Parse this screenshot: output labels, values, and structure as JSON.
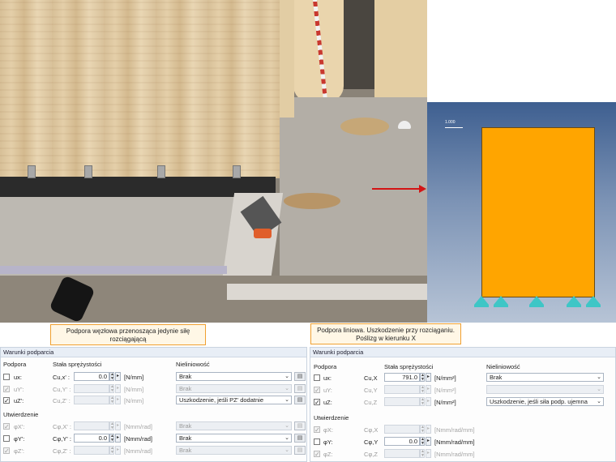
{
  "callouts": {
    "left": "Podpora węzłowa przenosząca jedynie siłę rozciągającą",
    "right": "Podpora liniowa. Uszkodzenie przy rozciąganiu. Poślizg w kierunku X"
  },
  "model_view": {
    "scale_label": "1.000",
    "panel_color": "#ffa500",
    "support_color": "#3ec6c6",
    "background_top": "#3e5f90"
  },
  "left_dialog": {
    "title": "Warunki podparcia",
    "headers": {
      "support": "Podpora",
      "stiffness": "Stała sprężystości",
      "nonlinearity": "Nieliniowość"
    },
    "section_fix": "Utwierdzenie",
    "rows": [
      {
        "label": "ux:",
        "symbol": "Cu,x' :",
        "checked": false,
        "enabled": true,
        "value": "0.0",
        "unit": "[N/mm]",
        "nonlinearity": "Brak",
        "nl_enabled": true
      },
      {
        "label": "uY':",
        "symbol": "Cu,Y' :",
        "checked": true,
        "enabled": false,
        "value": "",
        "unit": "[N/mm]",
        "nonlinearity": "Brak",
        "nl_enabled": false
      },
      {
        "label": "uZ':",
        "symbol": "Cu,Z' :",
        "checked": true,
        "enabled": false,
        "value": "",
        "unit": "[N/mm]",
        "nonlinearity": "Uszkodzenie, jeśli PZ' dodatnie",
        "nl_enabled": true
      }
    ],
    "rot_rows": [
      {
        "label": "φX':",
        "symbol": "Cφ,X' :",
        "checked": true,
        "enabled": false,
        "value": "",
        "unit": "[Nmm/rad]",
        "nonlinearity": "Brak",
        "nl_enabled": false
      },
      {
        "label": "φY':",
        "symbol": "Cφ,Y' :",
        "checked": false,
        "enabled": true,
        "value": "0.0",
        "unit": "[Nmm/rad]",
        "nonlinearity": "Brak",
        "nl_enabled": true
      },
      {
        "label": "φZ':",
        "symbol": "Cφ,Z' :",
        "checked": true,
        "enabled": false,
        "value": "",
        "unit": "[Nmm/rad]",
        "nonlinearity": "Brak",
        "nl_enabled": false
      }
    ]
  },
  "right_dialog": {
    "title": "Warunki podparcia",
    "headers": {
      "support": "Podpora",
      "stiffness": "Stała sprężystości",
      "nonlinearity": "Nieliniowość"
    },
    "section_fix": "Utwierdzenie",
    "rows": [
      {
        "label": "ux:",
        "symbol": "Cu,X",
        "checked": false,
        "enabled": true,
        "value": "791.0",
        "unit": "[N/mm²]",
        "nonlinearity": "Brak",
        "nl_enabled": true
      },
      {
        "label": "uY:",
        "symbol": "Cu,Y",
        "checked": true,
        "enabled": false,
        "value": "",
        "unit": "[N/mm²]",
        "nonlinearity": "",
        "nl_enabled": false
      },
      {
        "label": "uZ:",
        "symbol": "Cu,Z",
        "checked": true,
        "enabled": false,
        "value": "",
        "unit": "[N/mm²]",
        "nonlinearity": "Uszkodzenie, jeśli siła podp. ujemna",
        "nl_enabled": true
      }
    ],
    "rot_rows": [
      {
        "label": "φX:",
        "symbol": "Cφ,X",
        "checked": true,
        "enabled": false,
        "value": "",
        "unit": "[Nmm/rad/mm]"
      },
      {
        "label": "φY:",
        "symbol": "Cφ,Y",
        "checked": false,
        "enabled": true,
        "value": "0.0",
        "unit": "[Nmm/rad/mm]"
      },
      {
        "label": "φZ:",
        "symbol": "Cφ,Z",
        "checked": true,
        "enabled": false,
        "value": "",
        "unit": "[Nmm/rad/mm]"
      }
    ]
  }
}
